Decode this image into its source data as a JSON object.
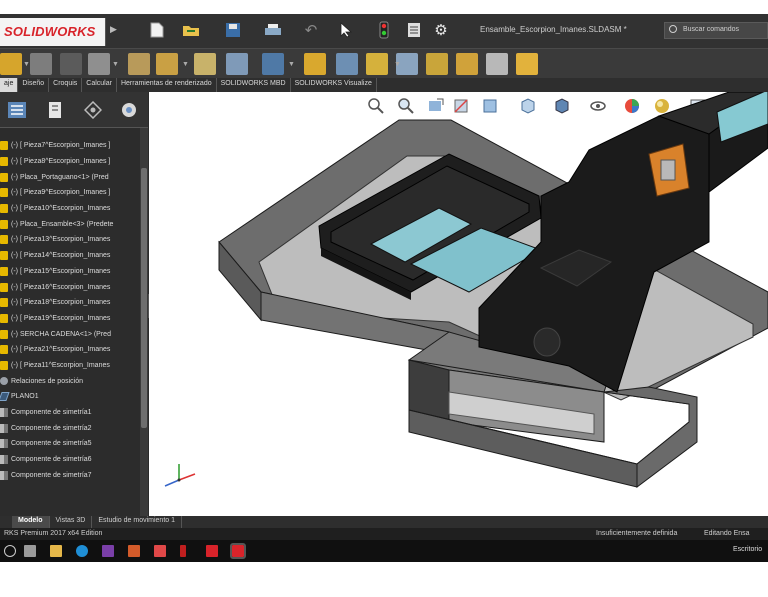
{
  "app": {
    "logo": "SOLIDWORKS",
    "document_title": "Ensamble_Escorpion_Imanes.SLDASM *",
    "search_placeholder": "Buscar comandos"
  },
  "ribbon_tabs": [
    "aje",
    "Diseño",
    "Croquis",
    "Calcular",
    "Herramientas de renderizado",
    "SOLIDWORKS MBD",
    "SOLIDWORKS Visualize"
  ],
  "feature_tree": [
    {
      "label": "(-) [ Pieza7^Escorpion_Imanes ]",
      "icon": "part-icon"
    },
    {
      "label": "(-) [ Pieza8^Escorpion_Imanes ]",
      "icon": "part-icon"
    },
    {
      "label": "(-) Placa_Portaguano<1> (Pred",
      "icon": "part-icon"
    },
    {
      "label": "(-) [ Pieza9^Escorpion_Imanes ]",
      "icon": "part-icon"
    },
    {
      "label": "(-) [ Pieza10^Escorpion_Imanes",
      "icon": "part-icon"
    },
    {
      "label": "(-) Placa_Ensamble<3> (Predete",
      "icon": "part-icon"
    },
    {
      "label": "(-) [ Pieza13^Escorpion_Imanes",
      "icon": "part-icon"
    },
    {
      "label": "(-) [ Pieza14^Escorpion_Imanes",
      "icon": "part-icon"
    },
    {
      "label": "(-) [ Pieza15^Escorpion_Imanes",
      "icon": "part-icon"
    },
    {
      "label": "(-) [ Pieza16^Escorpion_Imanes",
      "icon": "part-icon"
    },
    {
      "label": "(-) [ Pieza18^Escorpion_Imanes",
      "icon": "part-icon"
    },
    {
      "label": "(-) [ Pieza19^Escorpion_Imanes",
      "icon": "part-icon"
    },
    {
      "label": "(-) SERCHA CADENA<1> (Pred",
      "icon": "part-icon"
    },
    {
      "label": "(-) [ Pieza21^Escorpion_Imanes",
      "icon": "part-icon"
    },
    {
      "label": "(-) [ Pieza11^Escorpion_Imanes",
      "icon": "part-icon"
    },
    {
      "label": "Relaciones de posición",
      "icon": "mate-icon"
    },
    {
      "label": "PLANO1",
      "icon": "plane-icon"
    },
    {
      "label": "Componente de simetría1",
      "icon": "mirror-icon"
    },
    {
      "label": "Componente de simetría2",
      "icon": "mirror-icon"
    },
    {
      "label": "Componente de simetría5",
      "icon": "mirror-icon"
    },
    {
      "label": "Componente de simetría6",
      "icon": "mirror-icon"
    },
    {
      "label": "Componente de simetría7",
      "icon": "mirror-icon"
    }
  ],
  "model_tabs": [
    "Modelo",
    "Vistas 3D",
    "Estudio de movimiento 1"
  ],
  "status": {
    "left": "RKS Premium 2017 x64 Edition",
    "middle": "Insuficientemente definida",
    "right": "Editando Ensa"
  },
  "taskbar": {
    "right_text": "Escritorio"
  },
  "colors": {
    "ui_dark": "#2b2b2b",
    "brand_red": "#d8232a",
    "model_gray": "#777777",
    "model_black": "#1e1e1e",
    "glass_cyan": "#80c9d4",
    "bracket_orange": "#d9822b"
  }
}
